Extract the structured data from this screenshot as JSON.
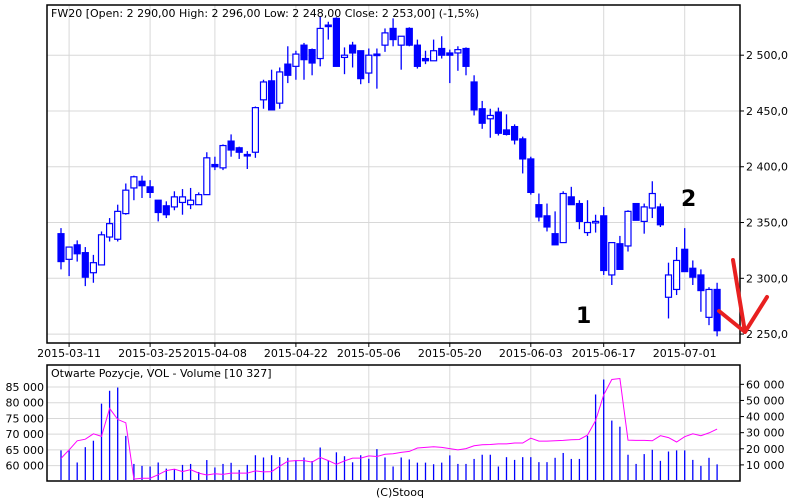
{
  "colors": {
    "candle": "#0000ff",
    "oi_line": "#ff00ff",
    "grid": "#d8d8d8",
    "annotation_arrow": "#e82020"
  },
  "credit": "(C)Stooq",
  "chart_data": [
    {
      "type": "candlestick",
      "title": "FW20 [Open: 2 290,00  High: 2 296,00  Low: 2 248,00  Close: 2 253,00] (-1,5%)",
      "yaxis_side": "right",
      "ylim": [
        2242,
        2545
      ],
      "yticks": [
        2250,
        2300,
        2350,
        2400,
        2450,
        2500
      ],
      "ytick_labels": [
        "2 250,0",
        "2 300,0",
        "2 350,0",
        "2 400,0",
        "2 450,0",
        "2 500,0"
      ],
      "xticks": [
        {
          "index": 1,
          "label": "2015-03-11"
        },
        {
          "index": 11,
          "label": "2015-03-25"
        },
        {
          "index": 19,
          "label": "2015-04-08"
        },
        {
          "index": 29,
          "label": "2015-04-22"
        },
        {
          "index": 38,
          "label": "2015-05-06"
        },
        {
          "index": 48,
          "label": "2015-05-20"
        },
        {
          "index": 58,
          "label": "2015-06-03"
        },
        {
          "index": 67,
          "label": "2015-06-17"
        },
        {
          "index": 77,
          "label": "2015-07-01"
        }
      ],
      "grid": true,
      "ohlc": [
        [
          2340,
          2345,
          2308,
          2315
        ],
        [
          2317,
          2328,
          2302,
          2328
        ],
        [
          2330,
          2334,
          2315,
          2322
        ],
        [
          2323,
          2328,
          2293,
          2301
        ],
        [
          2305,
          2321,
          2296,
          2314
        ],
        [
          2312,
          2342,
          2312,
          2339
        ],
        [
          2337,
          2354,
          2333,
          2349
        ],
        [
          2335,
          2366,
          2333,
          2360
        ],
        [
          2358,
          2385,
          2357,
          2379
        ],
        [
          2381,
          2392,
          2370,
          2391
        ],
        [
          2387,
          2392,
          2372,
          2383
        ],
        [
          2382,
          2388,
          2372,
          2377
        ],
        [
          2370,
          2370,
          2351,
          2359
        ],
        [
          2365,
          2369,
          2354,
          2357
        ],
        [
          2364,
          2378,
          2361,
          2373
        ],
        [
          2368,
          2380,
          2357,
          2373
        ],
        [
          2366,
          2381,
          2362,
          2370
        ],
        [
          2366,
          2377,
          2366,
          2375
        ],
        [
          2375,
          2413,
          2375,
          2408
        ],
        [
          2402,
          2409,
          2397,
          2400
        ],
        [
          2399,
          2420,
          2397,
          2419
        ],
        [
          2423,
          2429,
          2409,
          2415
        ],
        [
          2417,
          2418,
          2407,
          2413
        ],
        [
          2411,
          2414,
          2398,
          2411
        ],
        [
          2413,
          2454,
          2408,
          2453
        ],
        [
          2460,
          2478,
          2452,
          2476
        ],
        [
          2477,
          2487,
          2451,
          2451
        ],
        [
          2457,
          2489,
          2452,
          2485
        ],
        [
          2492,
          2508,
          2475,
          2482
        ],
        [
          2490,
          2504,
          2478,
          2501
        ],
        [
          2509,
          2511,
          2478,
          2496
        ],
        [
          2505,
          2506,
          2482,
          2493
        ],
        [
          2497,
          2535,
          2490,
          2524
        ],
        [
          2527,
          2530,
          2514,
          2527
        ],
        [
          2533,
          2534,
          2490,
          2490
        ],
        [
          2498,
          2507,
          2483,
          2500
        ],
        [
          2509,
          2512,
          2489,
          2502
        ],
        [
          2504,
          2504,
          2474,
          2479
        ],
        [
          2484,
          2506,
          2475,
          2500
        ],
        [
          2501,
          2506,
          2470,
          2500
        ],
        [
          2509,
          2524,
          2503,
          2520
        ],
        [
          2524,
          2533,
          2508,
          2514
        ],
        [
          2509,
          2517,
          2487,
          2517
        ],
        [
          2524,
          2525,
          2508,
          2509
        ],
        [
          2509,
          2514,
          2488,
          2490
        ],
        [
          2497,
          2504,
          2492,
          2495
        ],
        [
          2495,
          2514,
          2495,
          2504
        ],
        [
          2506,
          2517,
          2497,
          2500
        ],
        [
          2502,
          2505,
          2475,
          2500
        ],
        [
          2502,
          2508,
          2486,
          2505
        ],
        [
          2506,
          2507,
          2482,
          2490
        ],
        [
          2476,
          2482,
          2446,
          2451
        ],
        [
          2452,
          2459,
          2434,
          2439
        ],
        [
          2443,
          2452,
          2426,
          2446
        ],
        [
          2449,
          2453,
          2428,
          2430
        ],
        [
          2433,
          2447,
          2428,
          2429
        ],
        [
          2436,
          2438,
          2420,
          2424
        ],
        [
          2425,
          2427,
          2394,
          2407
        ],
        [
          2407,
          2409,
          2375,
          2377
        ],
        [
          2366,
          2376,
          2351,
          2355
        ],
        [
          2356,
          2367,
          2342,
          2346
        ],
        [
          2340,
          2360,
          2330,
          2330
        ],
        [
          2332,
          2378,
          2332,
          2376
        ],
        [
          2373,
          2382,
          2366,
          2366
        ],
        [
          2367,
          2370,
          2344,
          2351
        ],
        [
          2341,
          2370,
          2338,
          2350
        ],
        [
          2350,
          2357,
          2341,
          2351
        ],
        [
          2356,
          2364,
          2303,
          2307
        ],
        [
          2303,
          2332,
          2294,
          2332
        ],
        [
          2331,
          2338,
          2308,
          2308
        ],
        [
          2329,
          2361,
          2324,
          2360
        ],
        [
          2367,
          2367,
          2352,
          2352
        ],
        [
          2351,
          2367,
          2340,
          2364
        ],
        [
          2363,
          2387,
          2354,
          2376
        ],
        [
          2364,
          2367,
          2346,
          2348
        ],
        [
          2283,
          2314,
          2264,
          2303
        ],
        [
          2290,
          2328,
          2285,
          2316
        ],
        [
          2326,
          2345,
          2306,
          2306
        ],
        [
          2309,
          2316,
          2294,
          2301
        ],
        [
          2303,
          2308,
          2270,
          2289
        ],
        [
          2265,
          2292,
          2258,
          2290
        ],
        [
          2290,
          2296,
          2248,
          2253
        ]
      ],
      "annotations": [
        {
          "text": "1"
        },
        {
          "text": "2"
        }
      ]
    },
    {
      "type": "bar+line",
      "title": "Otwarte Pozycje, VOL - Volume [10 327]",
      "left_axis": {
        "series": "Otwarte Pozycje",
        "ylim": [
          55100,
          92000
        ],
        "ticks": [
          60000,
          65000,
          70000,
          75000,
          80000,
          85000
        ],
        "tick_labels": [
          "60 000",
          "65 000",
          "70 000",
          "75 000",
          "80 000",
          "85 000"
        ]
      },
      "right_axis": {
        "series": "Volume",
        "ylim": [
          0,
          72000
        ],
        "ticks": [
          10000,
          20000,
          30000,
          40000,
          50000,
          60000
        ],
        "tick_labels": [
          "10 000",
          "20 000",
          "30 000",
          "40 000",
          "50 000",
          "60 000"
        ]
      },
      "volume": [
        19000,
        19000,
        11500,
        21000,
        25000,
        48000,
        56000,
        58000,
        28000,
        10600,
        9400,
        9000,
        11500,
        7700,
        7300,
        10000,
        10600,
        5600,
        13000,
        8400,
        10600,
        11300,
        6900,
        10000,
        16000,
        14600,
        16000,
        14800,
        14400,
        13000,
        14600,
        12400,
        20800,
        12400,
        17800,
        15400,
        11600,
        16000,
        13800,
        19800,
        14600,
        9000,
        14600,
        13400,
        11400,
        11400,
        10400,
        11400,
        15900,
        10600,
        10600,
        13700,
        16300,
        16300,
        9000,
        14800,
        13100,
        14800,
        14800,
        11700,
        11700,
        14400,
        17400,
        13700,
        13700,
        28000,
        53700,
        63000,
        37500,
        33700,
        16300,
        10600,
        16700,
        19400,
        12500,
        18300,
        19000,
        19000,
        13100,
        9400,
        14400,
        10327
      ],
      "open_interest": [
        62300,
        65000,
        67900,
        68400,
        70100,
        69300,
        78200,
        74700,
        73600,
        55700,
        56000,
        56000,
        57100,
        58400,
        58900,
        58100,
        58700,
        57600,
        57000,
        57400,
        57200,
        57600,
        57600,
        57600,
        58300,
        58000,
        58100,
        59800,
        61400,
        61600,
        61600,
        61100,
        62600,
        61600,
        60400,
        61500,
        62400,
        62400,
        63100,
        62900,
        63600,
        63800,
        64200,
        64500,
        65600,
        65800,
        66000,
        65800,
        65400,
        65000,
        65400,
        66300,
        66600,
        66700,
        66900,
        66900,
        67200,
        67200,
        68700,
        67800,
        67800,
        67900,
        68000,
        68200,
        68300,
        69700,
        74300,
        82500,
        87400,
        87700,
        68100,
        68000,
        68000,
        67900,
        69500,
        68900,
        67500,
        69200,
        70100,
        69500,
        70400,
        71600
      ]
    }
  ]
}
